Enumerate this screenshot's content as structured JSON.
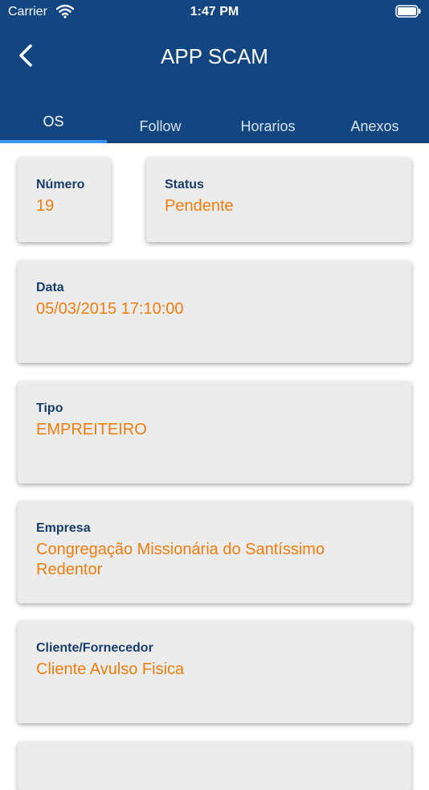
{
  "status_bar": {
    "carrier": "Carrier",
    "time": "1:47 PM"
  },
  "header": {
    "title": "APP SCAM"
  },
  "tabs": [
    {
      "label": "OS"
    },
    {
      "label": "Follow"
    },
    {
      "label": "Horarios"
    },
    {
      "label": "Anexos"
    }
  ],
  "fields": {
    "numero": {
      "label": "Número",
      "value": "19"
    },
    "status": {
      "label": "Status",
      "value": "Pendente"
    },
    "data": {
      "label": "Data",
      "value": "05/03/2015 17:10:00"
    },
    "tipo": {
      "label": "Tipo",
      "value": "EMPREITEIRO"
    },
    "empresa": {
      "label": "Empresa",
      "value": "Congregação Missionária do Santíssimo Redentor"
    },
    "cliente": {
      "label": "Cliente/Fornecedor",
      "value": "Cliente Avulso Fisica"
    }
  },
  "colors": {
    "header": "#134681",
    "accent": "#ee7d10",
    "label": "#183d6b",
    "tab_indicator": "#3a92ef",
    "card": "#ececec"
  },
  "icons": [
    "wifi-icon",
    "battery-icon",
    "back-chevron-icon"
  ]
}
